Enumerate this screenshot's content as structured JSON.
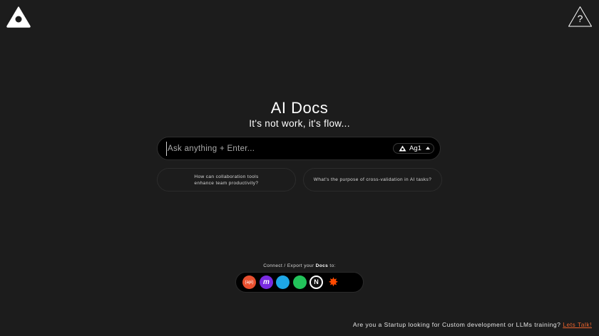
{
  "header": {
    "logo_icon": "triangle-logo-icon",
    "help_icon": "help-triangle-icon",
    "help_symbol": "?"
  },
  "hero": {
    "title": "AI Docs",
    "subtitle": "It's not work, it's flow..."
  },
  "search": {
    "placeholder": "Ask anything + Enter...",
    "value": "",
    "model_label": "Ag1",
    "model_icon": "triangle-logo-icon",
    "caret_icon": "caret-up-icon"
  },
  "suggestions": [
    {
      "label": "How can collaboration tools enhance team productivity?"
    },
    {
      "label": "What's the purpose of cross-validation in AI tasks?"
    }
  ],
  "connect": {
    "label_prefix": "Connect / Export your ",
    "label_strong": "Docs",
    "label_suffix": " to:",
    "integrations": [
      {
        "name": "api-icon",
        "glyph": "(api)",
        "color": "#e9502f"
      },
      {
        "name": "make-icon",
        "glyph": "m",
        "color": "#7a2be0"
      },
      {
        "name": "blue-circle-icon",
        "glyph": "",
        "color": "#1ea7e6"
      },
      {
        "name": "green-circle-icon",
        "glyph": "",
        "color": "#22c35a"
      },
      {
        "name": "notion-icon",
        "glyph": "N",
        "color": "#ffffff"
      },
      {
        "name": "zapier-icon",
        "glyph": "✸",
        "color": "#ff4a00"
      }
    ]
  },
  "footer": {
    "text": "Are you a Startup looking for Custom development or LLMs training?",
    "link": "Lets Talk!",
    "link_color": "#e8622d"
  },
  "colors": {
    "background": "#1c1c1c",
    "input_background": "#000000",
    "accent": "#e8622d"
  }
}
